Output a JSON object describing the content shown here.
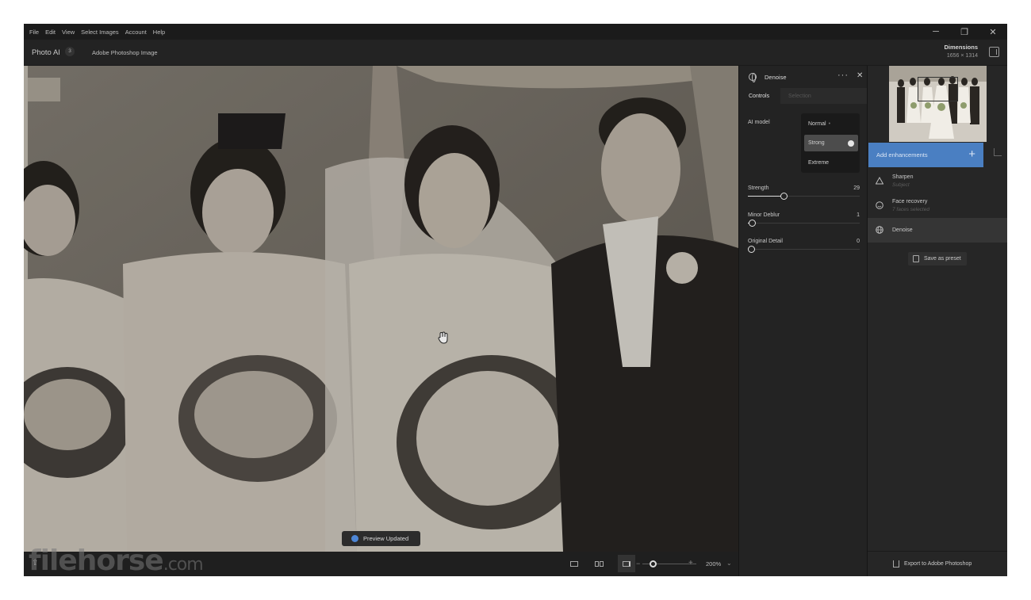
{
  "menu": [
    "File",
    "Edit",
    "View",
    "Select Images",
    "Account",
    "Help"
  ],
  "window_controls": {
    "minimize": "─",
    "restore": "❐",
    "close": "✕"
  },
  "header": {
    "app_title": "Photo AI",
    "image_count": "3",
    "source": "Adobe Photoshop Image",
    "dimensions_label": "Dimensions",
    "dimensions_value": "1656 × 1314"
  },
  "canvas": {
    "toast": "Preview Updated",
    "watermark_main": "filehorse",
    "watermark_suffix": ".com",
    "zoom_value": "200%",
    "zoom_minus": "−",
    "zoom_plus": "+",
    "zoom_chevron": "⌄",
    "upload_icon": "⇪"
  },
  "controls": {
    "title": "Denoise",
    "more": "···",
    "close": "✕",
    "tabs": [
      "Controls",
      "Selection"
    ],
    "ai_model_label": "AI model",
    "models": [
      "Normal",
      "Strong",
      "Extreme"
    ],
    "model_normal_marker": "•",
    "selected_model": "Strong",
    "sliders": [
      {
        "label": "Strength",
        "value": "29",
        "fraction": 0.29
      },
      {
        "label": "Minor Deblur",
        "value": "1",
        "fraction": 0.01
      },
      {
        "label": "Original Detail",
        "value": "0",
        "fraction": 0.0
      }
    ]
  },
  "sidebar": {
    "add_label": "Add enhancements",
    "add_plus": "+",
    "enhancements": [
      {
        "name": "Sharpen",
        "sub": "Subject"
      },
      {
        "name": "Face recovery",
        "sub": "7 faces selected"
      },
      {
        "name": "Denoise",
        "sub": ""
      }
    ],
    "preset_label": "Save as preset",
    "export_label": "Export to Adobe Photoshop"
  },
  "colors": {
    "accent": "#4a7fc2",
    "background": "#1f1f1f",
    "panel": "#232323"
  }
}
